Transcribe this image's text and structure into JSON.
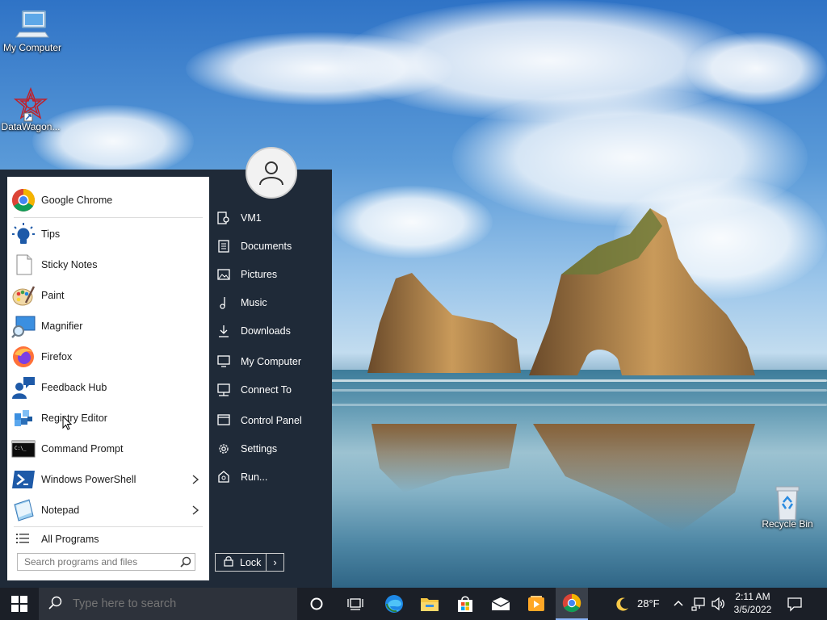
{
  "desktop": {
    "icons": [
      {
        "label": "My Computer",
        "icon": "computer-icon"
      },
      {
        "label": "DataWagon...",
        "icon": "datawagon-icon"
      },
      {
        "label": "Recycle Bin",
        "icon": "recycle-bin-icon"
      }
    ]
  },
  "start_menu": {
    "apps": [
      {
        "label": "Google Chrome",
        "icon": "chrome-icon"
      },
      {
        "label": "Tips",
        "icon": "lightbulb-icon"
      },
      {
        "label": "Sticky Notes",
        "icon": "sticky-notes-icon"
      },
      {
        "label": "Paint",
        "icon": "paint-palette-icon"
      },
      {
        "label": "Magnifier",
        "icon": "magnifier-icon"
      },
      {
        "label": "Firefox",
        "icon": "firefox-icon"
      },
      {
        "label": "Feedback Hub",
        "icon": "feedback-hub-icon"
      },
      {
        "label": "Registry Editor",
        "icon": "registry-editor-icon"
      },
      {
        "label": "Command Prompt",
        "icon": "command-prompt-icon"
      },
      {
        "label": "Windows PowerShell",
        "icon": "powershell-icon",
        "submenu": true
      },
      {
        "label": "Notepad",
        "icon": "notepad-icon",
        "submenu": true
      }
    ],
    "all_programs": "All Programs",
    "search_placeholder": "Search programs and files",
    "places": [
      {
        "label": "VM1",
        "icon": "user-folder-icon"
      },
      {
        "label": "Documents",
        "icon": "document-icon"
      },
      {
        "label": "Pictures",
        "icon": "picture-icon"
      },
      {
        "label": "Music",
        "icon": "music-note-icon"
      },
      {
        "label": "Downloads",
        "icon": "download-icon"
      },
      {
        "label": "My Computer",
        "icon": "computer-icon"
      },
      {
        "label": "Connect To",
        "icon": "connect-icon"
      },
      {
        "label": "Control Panel",
        "icon": "control-panel-icon"
      },
      {
        "label": "Settings",
        "icon": "gear-icon"
      },
      {
        "label": "Run...",
        "icon": "run-icon"
      }
    ],
    "lock_label": "Lock",
    "lock_arrow": "›"
  },
  "taskbar": {
    "search_placeholder": "Type here to search",
    "weather": "28°F",
    "time": "2:11 AM",
    "date": "3/5/2022",
    "pinned": [
      "cortana-icon",
      "task-view-icon",
      "edge-icon",
      "file-explorer-icon",
      "store-icon",
      "mail-icon",
      "media-player-icon",
      "chrome-icon"
    ]
  },
  "colors": {
    "start_menu_bg": "#1f2a38",
    "taskbar_bg": "#1b1f27",
    "accent": "#8ab4f8"
  }
}
